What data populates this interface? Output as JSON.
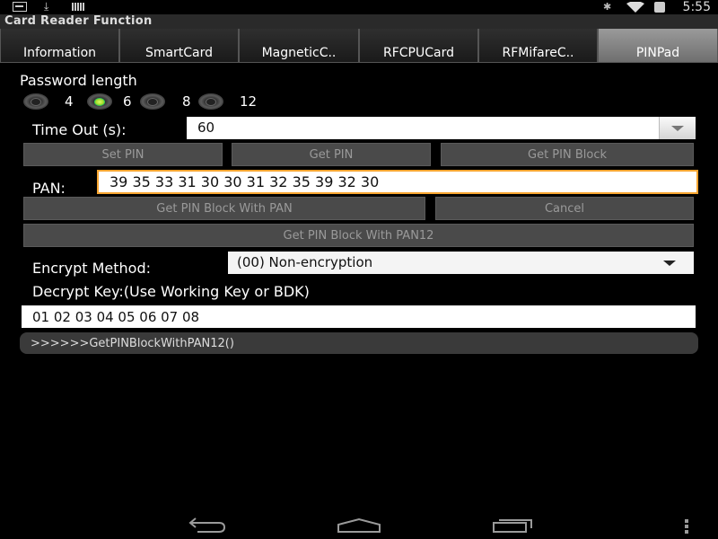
{
  "status_bar": {
    "time": "5:55",
    "left_icons": [
      "notification-icon",
      "download-icon",
      "barcode-icon"
    ],
    "right_icons": [
      "bluetooth-icon",
      "wifi-icon",
      "battery-icon"
    ]
  },
  "app": {
    "title": "Card Reader Function"
  },
  "tabs": [
    {
      "label": "Information",
      "active": false
    },
    {
      "label": "SmartCard",
      "active": false
    },
    {
      "label": "MagneticC..",
      "active": false
    },
    {
      "label": "RFCPUCard",
      "active": false
    },
    {
      "label": "RFMifareC..",
      "active": false
    },
    {
      "label": "PINPad",
      "active": true
    }
  ],
  "password_length": {
    "label": "Password length",
    "options": [
      "4",
      "6",
      "8",
      "12"
    ],
    "selected": "6"
  },
  "timeout": {
    "label": "Time Out (s):",
    "value": "60"
  },
  "buttons": {
    "set_pin": "Set PIN",
    "get_pin": "Get PIN",
    "get_pin_block": "Get PIN Block",
    "get_pin_block_with_pan": "Get PIN Block With PAN",
    "cancel": "Cancel",
    "get_pin_block_with_pan12": "Get PIN Block With PAN12"
  },
  "pan": {
    "label": "PAN:",
    "value": "39 35 33 31 30 30 31 32 35 39 32 30"
  },
  "encrypt_method": {
    "label": "Encrypt Method:",
    "value": "(00) Non-encryption"
  },
  "decrypt_key": {
    "label": "Decrypt Key:(Use Working Key or BDK)",
    "value": "01 02 03 04 05 06 07 08"
  },
  "log": {
    "text": ">>>>>>GetPINBlockWithPAN12()"
  },
  "nav_icons": [
    "back-icon",
    "home-icon",
    "recent-apps-icon",
    "menu-icon"
  ],
  "colors": {
    "focus_border": "#f7a531",
    "radio_selected": "#7ec100",
    "active_tab": "#8a8a8a"
  }
}
